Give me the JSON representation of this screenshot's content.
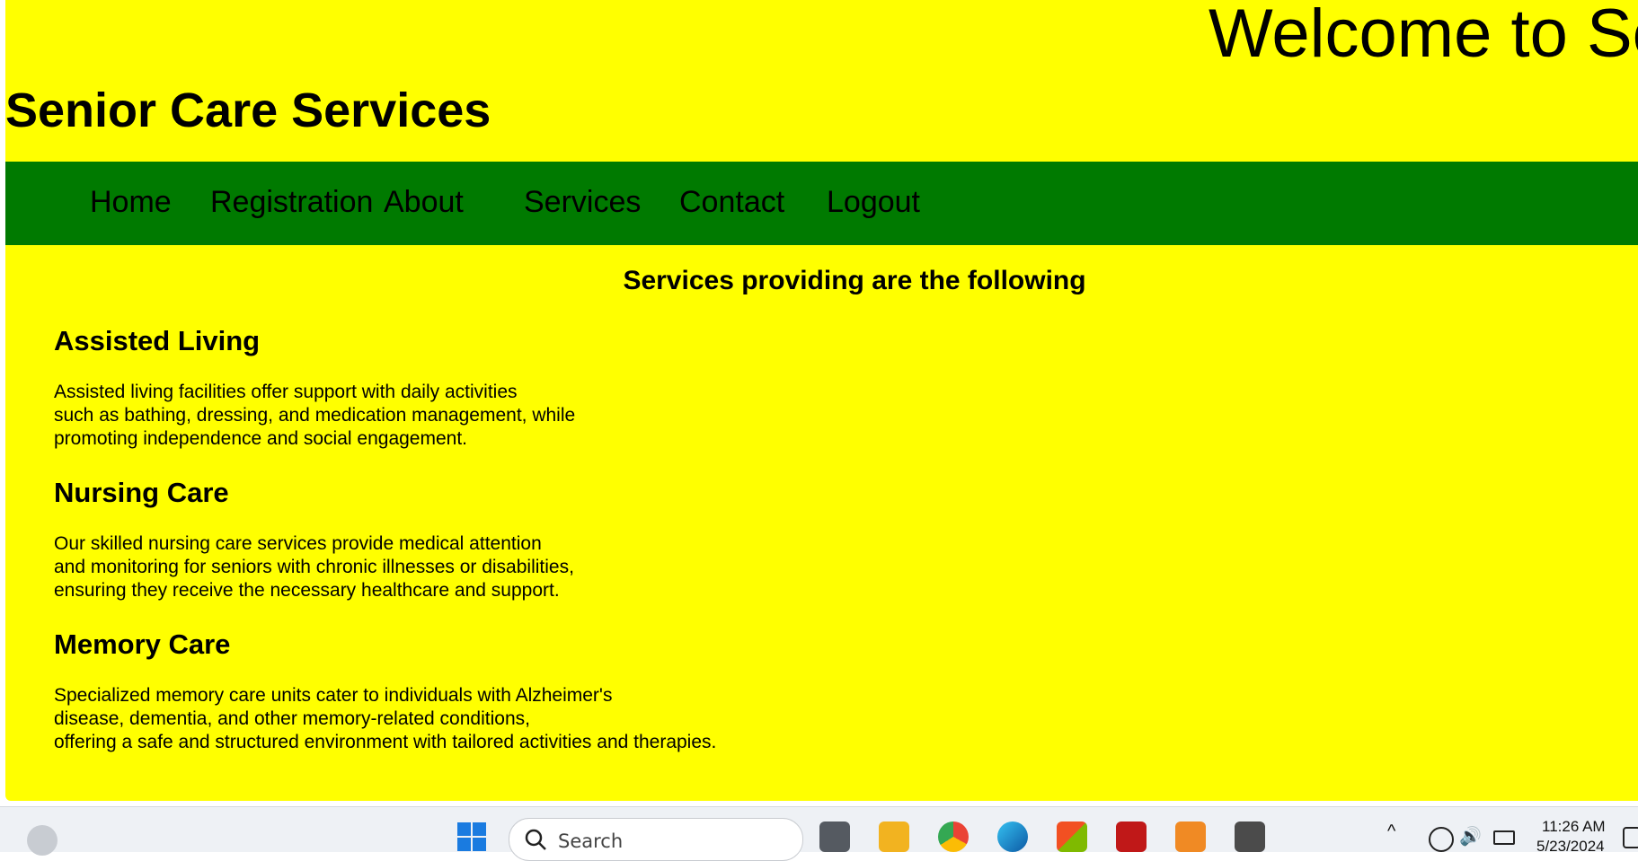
{
  "header": {
    "welcome": "Welcome to Se",
    "site_title": "Senior Care Services"
  },
  "nav": {
    "items": [
      "Home",
      "Registration",
      "About",
      "Services",
      "Contact",
      "Logout"
    ],
    "background": "#007a00"
  },
  "main": {
    "heading": "Services providing are the following",
    "services": [
      {
        "title": "Assisted Living",
        "description": "Assisted living facilities offer support with daily activities\nsuch as bathing, dressing, and medication management, while\npromoting independence and social engagement."
      },
      {
        "title": "Nursing Care",
        "description": "Our skilled nursing care services provide medical attention\nand monitoring for seniors with chronic illnesses or disabilities,\nensuring they receive the necessary healthcare and support."
      },
      {
        "title": "Memory Care",
        "description": "Specialized memory care units cater to individuals with Alzheimer's\ndisease, dementia, and other memory-related conditions,\noffering a safe and structured environment with tailored activities and therapies."
      }
    ]
  },
  "colors": {
    "page_background": "#ffff00",
    "nav_background": "#007a00",
    "text": "#000000"
  },
  "taskbar": {
    "search_placeholder": "Search",
    "time": "11:26 AM",
    "date": "5/23/2024",
    "icons": [
      "weather-icon",
      "windows-start-icon",
      "search-icon",
      "task-view-icon",
      "file-explorer-icon",
      "chrome-icon",
      "edge-icon",
      "microsoft-store-icon",
      "mcafee-icon",
      "xampp-icon",
      "sublime-text-icon",
      "chevron-up-icon",
      "network-icon",
      "volume-icon",
      "battery-icon",
      "notification-icon"
    ]
  }
}
